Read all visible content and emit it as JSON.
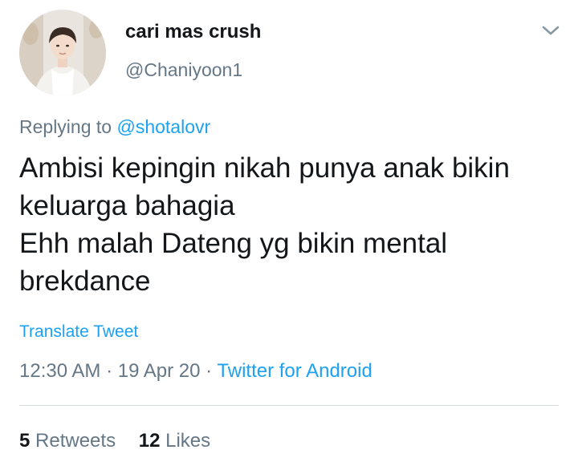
{
  "tweet": {
    "author": {
      "display_name": "cari mas crush",
      "handle": "@Chaniyoon1",
      "avatar_icon": "profile-photo"
    },
    "menu_icon": "chevron-down-icon",
    "replying_prefix": "Replying to",
    "replying_to": "@shotalovr",
    "text_lines": [
      "Ambisi kepingin nikah punya anak bikin",
      "keluarga bahagia",
      "Ehh malah Dateng yg bikin mental",
      "brekdance"
    ],
    "translate_label": "Translate Tweet",
    "time": "12:30 AM",
    "date": "19 Apr 20",
    "source": "Twitter for Android",
    "retweets": {
      "count": "5",
      "label": "Retweets"
    },
    "likes": {
      "count": "12",
      "label": "Likes"
    }
  },
  "colors": {
    "link": "#1da1f2",
    "secondary_text": "#657786",
    "primary_text": "#14171a",
    "divider": "#d9dee2"
  }
}
